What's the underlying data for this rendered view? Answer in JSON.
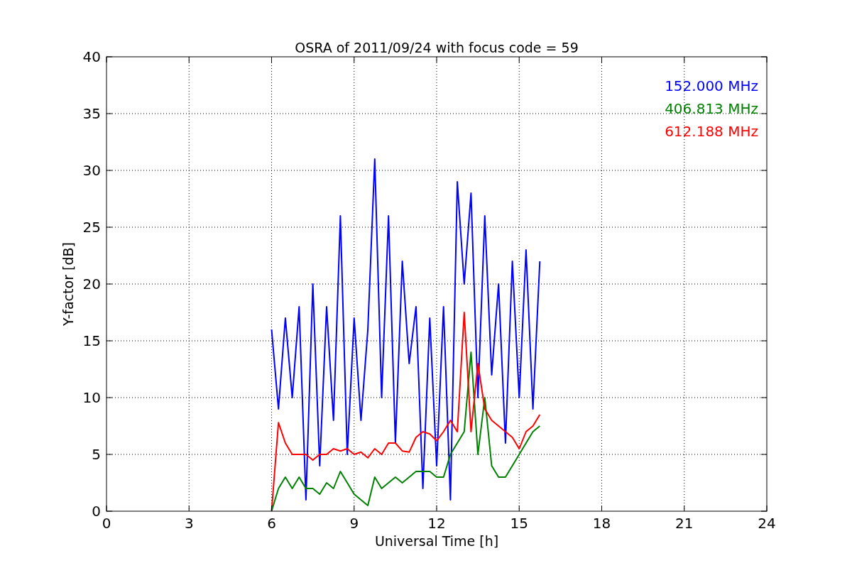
{
  "figure": {
    "chart_data": {
      "type": "line",
      "title": "OSRA of 2011/09/24 with focus code = 59",
      "xlabel": "Universal Time [h]",
      "ylabel": "Y-factor [dB]",
      "xlim": [
        0,
        24
      ],
      "ylim": [
        0,
        40
      ],
      "xticks": [
        0,
        3,
        6,
        9,
        12,
        15,
        18,
        21,
        24
      ],
      "yticks": [
        0,
        5,
        10,
        15,
        20,
        25,
        30,
        35,
        40
      ],
      "grid": true,
      "x": [
        6,
        6.25,
        6.5,
        6.75,
        7,
        7.25,
        7.5,
        7.75,
        8,
        8.25,
        8.5,
        8.75,
        9,
        9.25,
        9.5,
        9.75,
        10,
        10.25,
        10.5,
        10.75,
        11,
        11.25,
        11.5,
        11.75,
        12,
        12.25,
        12.5,
        12.75,
        13,
        13.25,
        13.5,
        13.75,
        14,
        14.25,
        14.5,
        14.75,
        15,
        15.25,
        15.5,
        15.75
      ],
      "series": [
        {
          "name": "152.000 MHz",
          "color": "#0000ff",
          "values": [
            16,
            9,
            17,
            10,
            18,
            1,
            20,
            4,
            18,
            8,
            26,
            5,
            17,
            8,
            16,
            31,
            10,
            26,
            6,
            22,
            13,
            18,
            2,
            17,
            4,
            18,
            1,
            29,
            20,
            28,
            10,
            26,
            12,
            20,
            6,
            22,
            10,
            23,
            9,
            22
          ]
        },
        {
          "name": "406.813 MHz",
          "color": "#008000",
          "values": [
            0,
            2,
            3,
            2,
            3,
            2,
            2,
            1.5,
            2.5,
            2,
            3.5,
            2.5,
            1.5,
            1,
            0.5,
            3,
            2,
            2.5,
            3,
            2.5,
            3,
            3.5,
            3.5,
            3.5,
            3,
            3,
            5,
            6,
            7,
            14,
            5,
            10,
            4,
            3,
            3,
            4,
            5,
            6,
            7,
            7.5
          ]
        },
        {
          "name": "612.188 MHz",
          "color": "#ff0000",
          "values": [
            0,
            7.8,
            6,
            5,
            5,
            5,
            4.5,
            5,
            5,
            5.5,
            5.3,
            5.5,
            5,
            5.2,
            4.7,
            5.5,
            5,
            6,
            6,
            5.3,
            5.2,
            6.5,
            7,
            6.8,
            6.2,
            7,
            8,
            7,
            17.5,
            7,
            13,
            9,
            8,
            7.5,
            7,
            6.5,
            5.5,
            7,
            7.5,
            8.5
          ]
        }
      ]
    }
  }
}
